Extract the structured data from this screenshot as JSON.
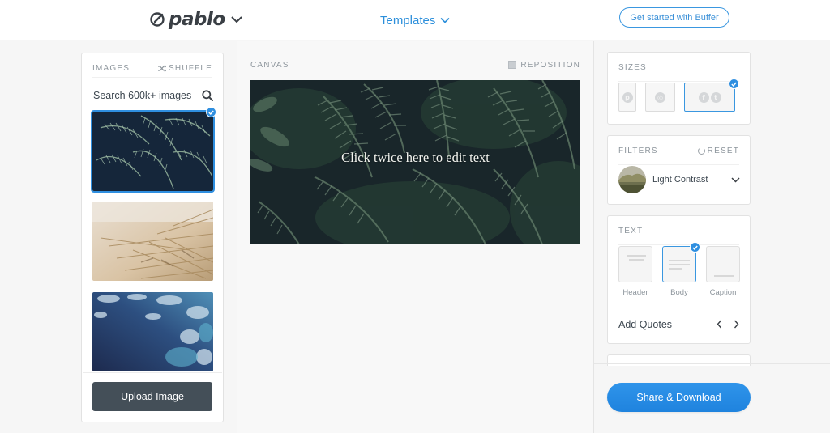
{
  "header": {
    "logo_text": "pablo",
    "templates_label": "Templates",
    "buffer_button": "Get started with Buffer"
  },
  "images": {
    "section_label": "IMAGES",
    "shuffle_label": "SHUFFLE",
    "search_placeholder": "Search 600k+ images",
    "thumbnails": [
      {
        "subject": "fern leaves",
        "selected": true
      },
      {
        "subject": "dry grass",
        "selected": false
      },
      {
        "subject": "water",
        "selected": false
      }
    ],
    "upload_button": "Upload Image"
  },
  "canvas": {
    "section_label": "CANVAS",
    "reposition_label": "REPOSITION",
    "overlay_text": "Click twice here to edit text"
  },
  "sizes": {
    "section_label": "SIZES",
    "options": [
      {
        "name": "pinterest",
        "glyph": "p",
        "selected": false
      },
      {
        "name": "instagram",
        "glyph": "◎",
        "selected": false
      },
      {
        "name": "facebook-twitter",
        "glyph": "f",
        "glyph2": "t",
        "selected": true
      }
    ]
  },
  "filters": {
    "section_label": "FILTERS",
    "reset_label": "RESET",
    "selected": "Light Contrast"
  },
  "text": {
    "section_label": "TEXT",
    "options": [
      {
        "label": "Header",
        "selected": false
      },
      {
        "label": "Body",
        "selected": true
      },
      {
        "label": "Caption",
        "selected": false
      }
    ],
    "quotes_label": "Add Quotes"
  },
  "actions": {
    "share_button": "Share & Download"
  },
  "colors": {
    "accent": "#2f8fe0",
    "upload_button_bg": "#444f58",
    "link": "#2c8fdb"
  }
}
